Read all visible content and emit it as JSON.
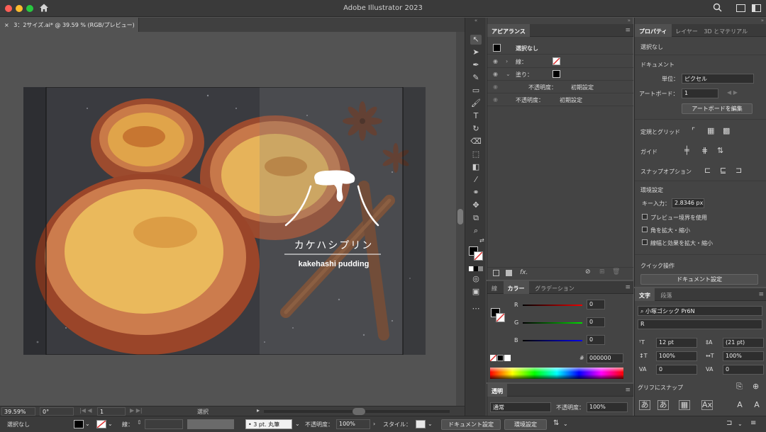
{
  "app": {
    "title": "Adobe Illustrator 2023"
  },
  "document": {
    "tab_close": "×",
    "tab_label": "3：2サイズ.ai* @ 39.59 % (RGB/プレビュー)"
  },
  "artwork": {
    "title_jp": "カケハシプリン",
    "title_en": "kakehashi pudding"
  },
  "canvas_status": {
    "zoom": "39.59%",
    "rotation": "0°",
    "artboard": "1",
    "tool": "選択"
  },
  "appearance": {
    "tab": "アピアランス",
    "selection": "選択なし",
    "stroke_label": "線：",
    "fill_label": "塗り：",
    "opacity_label": "不透明度：",
    "opacity_value": "初期設定",
    "fx": "fx."
  },
  "color": {
    "tabs": [
      "線",
      "カラー",
      "グラデーション"
    ],
    "r_label": "R",
    "g_label": "G",
    "b_label": "B",
    "r": "0",
    "g": "0",
    "b": "0",
    "hash": "#",
    "hex": "000000"
  },
  "transparency": {
    "tab": "透明",
    "mode": "通常",
    "opacity_label": "不透明度：",
    "opacity": "100%"
  },
  "properties": {
    "tabs": [
      "プロパティ",
      "レイヤー",
      "3D とマテリアル"
    ],
    "selection": "選択なし",
    "doc_section": "ドキュメント",
    "unit_label": "単位：",
    "unit_value": "ピクセル",
    "artboard_label": "アートボード：",
    "artboard_value": "1",
    "edit_artboard_button": "アートボードを編集",
    "rulers_grids": "定規とグリッド",
    "guides": "ガイド",
    "snap_options": "スナップオプション",
    "preferences": "環境設定",
    "key_input_label": "キー入力：",
    "key_input_value": "2.8346 px",
    "cb_preview_bounds": "プレビュー境界を使用",
    "cb_scale_corners": "角を拡大・縮小",
    "cb_scale_strokes": "線幅と効果を拡大・縮小",
    "quick_actions": "クイック操作",
    "doc_setup_button": "ドキュメント設定"
  },
  "character": {
    "tabs": [
      "文字",
      "段落"
    ],
    "font": "小塚ゴシック Pr6N",
    "style": "R",
    "size": "12 pt",
    "leading": "(21 pt)",
    "hscale": "100%",
    "vscale": "100%",
    "kerning": "0",
    "tracking": "0",
    "glyph_snap": "グリフにスナップ"
  },
  "statusbar": {
    "selection": "選択なし",
    "stroke_label": "線：",
    "stroke_profile": "3 pt. 丸筆",
    "opacity_label": "不透明度：",
    "opacity": "100%",
    "style_label": "スタイル：",
    "doc_setup": "ドキュメント設定",
    "preferences": "環境設定"
  },
  "colors": {
    "accent_red": "#e03030",
    "fill_black": "#000000",
    "overlay": "#ffffff"
  }
}
